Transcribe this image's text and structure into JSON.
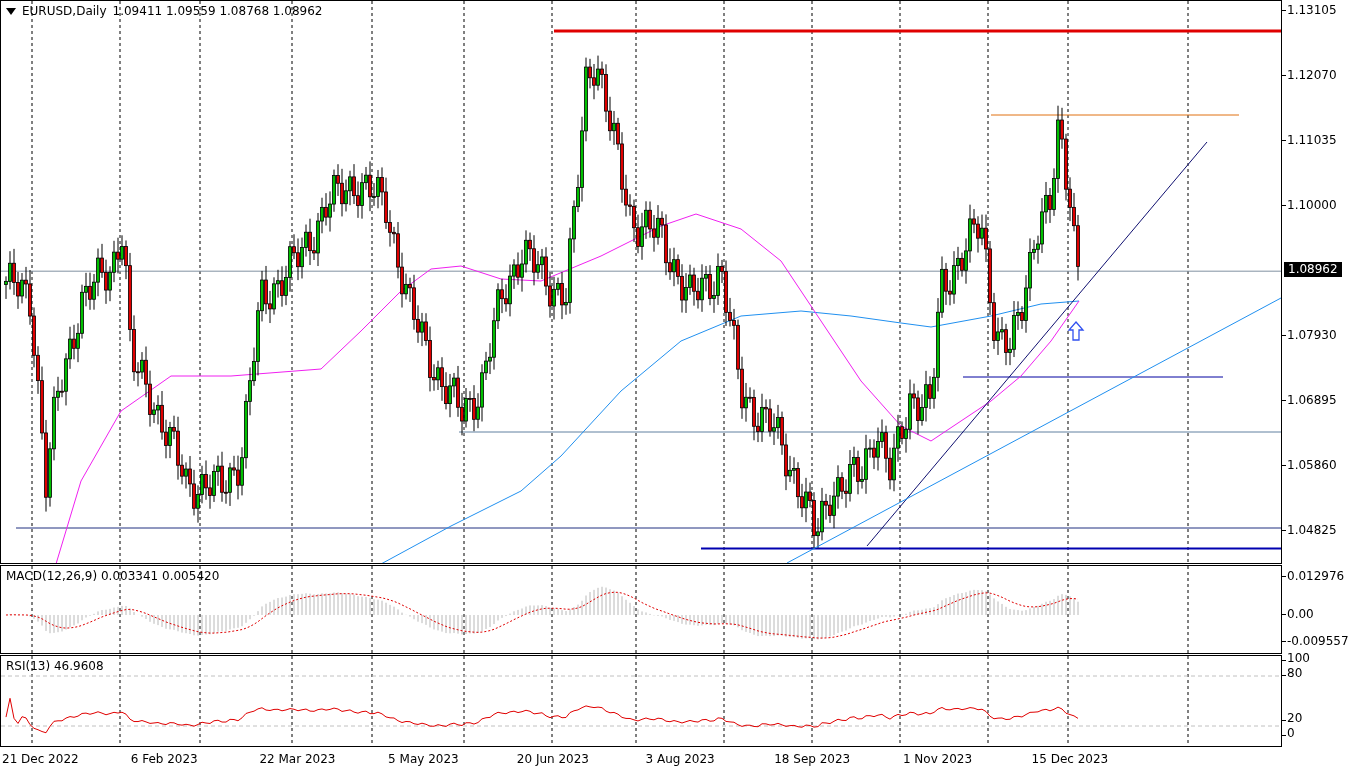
{
  "chart": {
    "symbol": "EURUSD,Daily",
    "ohlc": [
      "1.09411",
      "1.09559",
      "1.08768",
      "1.08962"
    ],
    "price_axis": [
      "1.13105",
      "1.12070",
      "1.11035",
      "1.10000",
      "1.07930",
      "1.06895",
      "1.05860",
      "1.04825"
    ],
    "current_price": "1.08962"
  },
  "macd": {
    "label": "MACD(12,26,9) 0.003341 0.005420",
    "axis": [
      "0.012976",
      "0.00",
      "-0.009557"
    ]
  },
  "rsi": {
    "label": "RSI(13) 46.9608",
    "axis": [
      "100",
      "80",
      "20",
      "0"
    ]
  },
  "time_axis": [
    "21 Dec 2022",
    "6 Feb 2023",
    "22 Mar 2023",
    "5 May 2023",
    "20 Jun 2023",
    "3 Aug 2023",
    "18 Sep 2023",
    "1 Nov 2023",
    "15 Dec 2023"
  ]
}
